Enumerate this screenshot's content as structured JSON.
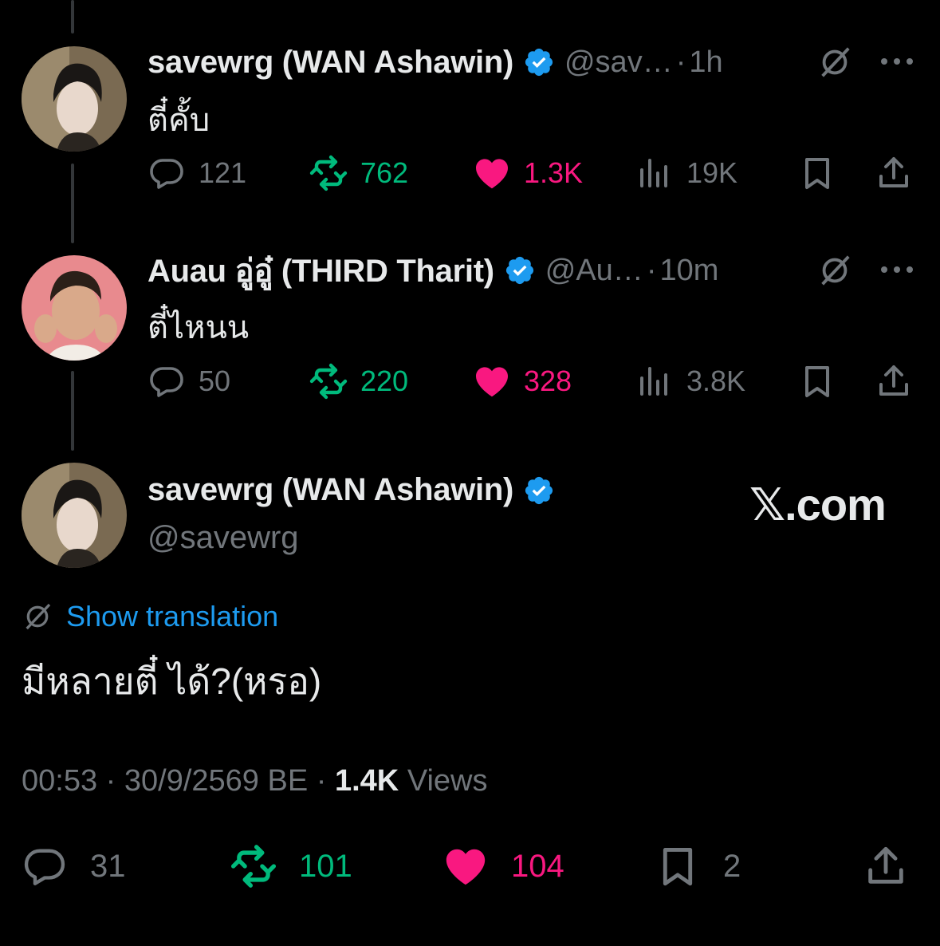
{
  "tweets": [
    {
      "name": "savewrg (WAN Ashawin)",
      "handle": "@sav…",
      "separator": "·",
      "time": "1h",
      "text": "ตี๋คั้บ",
      "stats": {
        "replies": "121",
        "reposts": "762",
        "likes": "1.3K",
        "views": "19K"
      }
    },
    {
      "name": "Auau อู่อู๋ (THIRD Tharit)",
      "handle": "@Au…",
      "separator": "·",
      "time": "10m",
      "text": "ตี๋ไหนน",
      "stats": {
        "replies": "50",
        "reposts": "220",
        "likes": "328",
        "views": "3.8K"
      }
    }
  ],
  "main": {
    "name": "savewrg (WAN Ashawin)",
    "handle": "@savewrg",
    "watermark": "𝕏.com",
    "translation_label": "Show translation",
    "text": "มีหลายตี๋ ได้?(หรอ)",
    "meta": {
      "time": "00:53",
      "sep1": "·",
      "date": "30/9/2569 BE",
      "sep2": "·",
      "views_count": "1.4K",
      "views_label": "Views"
    },
    "stats": {
      "replies": "31",
      "reposts": "101",
      "likes": "104",
      "bookmarks": "2"
    }
  },
  "colors": {
    "background": "#000000",
    "text": "#e7e9ea",
    "muted": "#71767b",
    "repost": "#00ba7c",
    "like": "#f91880",
    "link": "#1d9bf0",
    "verified": "#1d9bf0"
  },
  "icons": [
    "verified-badge-icon",
    "grok-icon",
    "more-icon",
    "reply-icon",
    "repost-icon",
    "like-icon",
    "views-icon",
    "bookmark-icon",
    "share-icon",
    "translate-icon"
  ]
}
